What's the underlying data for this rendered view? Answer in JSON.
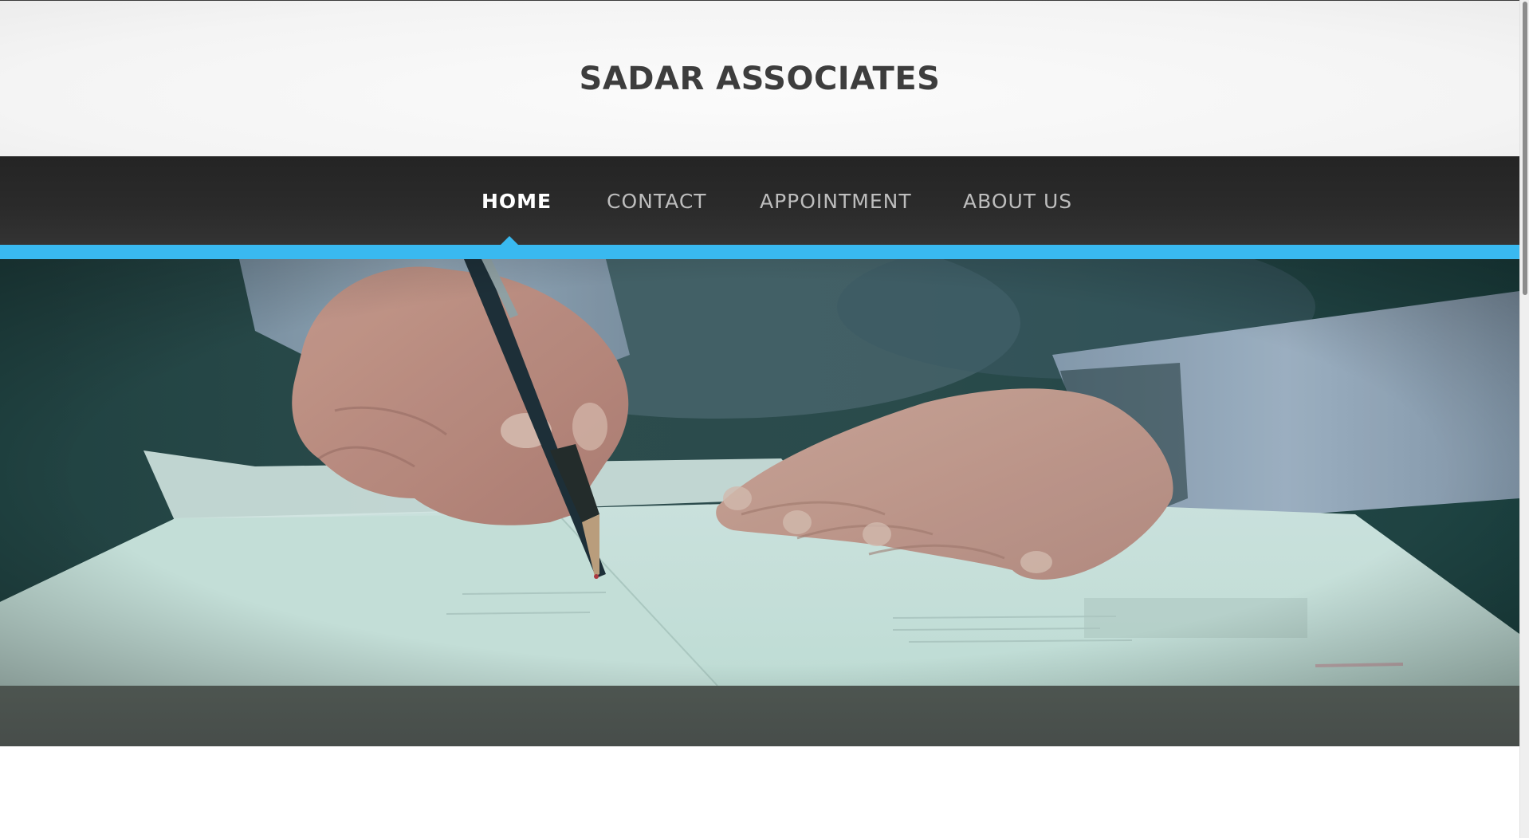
{
  "header": {
    "site_title": "SADAR ASSOCIATES"
  },
  "nav": {
    "items": [
      {
        "label": "HOME",
        "active": true
      },
      {
        "label": "CONTACT",
        "active": false
      },
      {
        "label": "APPOINTMENT",
        "active": false
      },
      {
        "label": "ABOUT US",
        "active": false
      }
    ]
  },
  "hero": {
    "image_subject": "hand-signing-document"
  },
  "colors": {
    "accent": "#39b9f0",
    "nav_background": "#2b2b2b",
    "title_text": "#3d3d3d",
    "nav_text": "#bdbdbd",
    "nav_active_text": "#ffffff"
  }
}
